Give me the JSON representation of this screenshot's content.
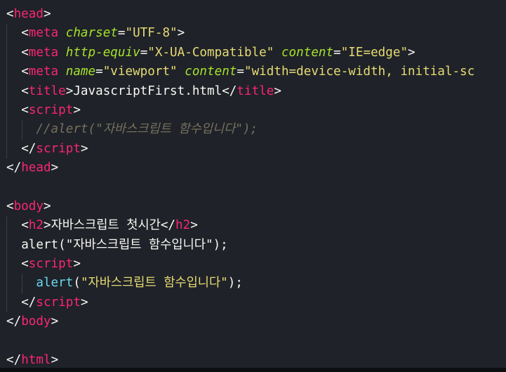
{
  "code": {
    "indent1": "  ",
    "indent2": "    ",
    "lt": "<",
    "gt": ">",
    "lt_slash": "</",
    "eq": "=",
    "space": " ",
    "lines": {
      "head_tag": "head",
      "meta_tag": "meta",
      "charset_attr": "charset",
      "charset_val": "\"UTF-8\"",
      "http_equiv_attr": "http-equiv",
      "http_equiv_val": "\"X-UA-Compatible\"",
      "content_attr": "content",
      "ie_edge_val": "\"IE=edge\"",
      "name_attr": "name",
      "viewport_val": "\"viewport\"",
      "viewport_content_val": "\"width=device-width, initial-sc",
      "title_tag": "title",
      "title_text": "JavascriptFirst.html",
      "script_tag": "script",
      "comment_text": "//alert(\"자바스크립트 함수입니다\");",
      "body_tag": "body",
      "h2_tag": "h2",
      "h2_text": "자바스크립트 첫시간",
      "alert_fn": "alert",
      "alert_open": "(",
      "alert_str": "\"자바스크립트 함수입니다\"",
      "alert_close": ");",
      "html_tag": "html"
    }
  }
}
